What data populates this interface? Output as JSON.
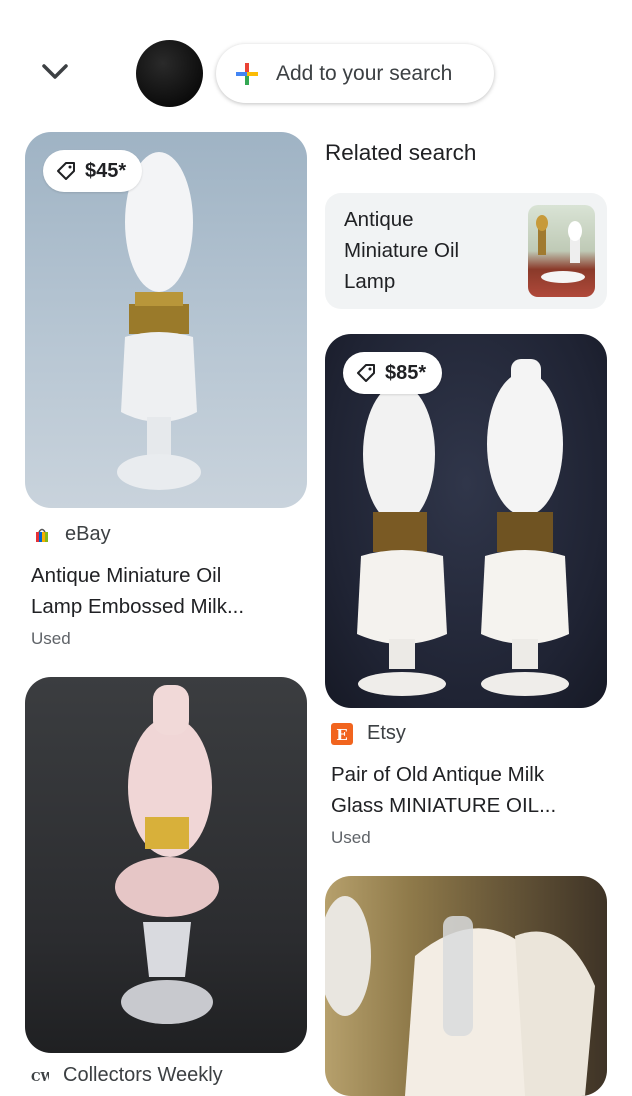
{
  "header": {
    "add_to_search_label": "Add to your search"
  },
  "cards": [
    {
      "price": "$45*",
      "source": "eBay",
      "title_line1": "Antique Miniature Oil",
      "title_line2": "Lamp Embossed Milk...",
      "condition": "Used"
    },
    {
      "price": "$85*",
      "source": "Etsy",
      "title_line1": "Pair of Old Antique Milk",
      "title_line2": "Glass MINIATURE OIL...",
      "condition": "Used"
    },
    {
      "source": "Collectors Weekly"
    }
  ],
  "related": {
    "heading": "Related search",
    "item_line1": "Antique",
    "item_line2": "Miniature Oil",
    "item_line3": "Lamp"
  },
  "icons": {
    "back": "chevron-down-icon",
    "add": "plus-icon",
    "price_tag": "tag-icon",
    "source_ebay": "ebay-bag-icon",
    "source_etsy": "etsy-icon",
    "source_cw": "collectors-weekly-icon"
  },
  "colors": {
    "etsy_orange": "#f1641e",
    "google_blue": "#4285f4",
    "google_red": "#ea4335",
    "google_yellow": "#fbbc05",
    "google_green": "#34a853"
  }
}
